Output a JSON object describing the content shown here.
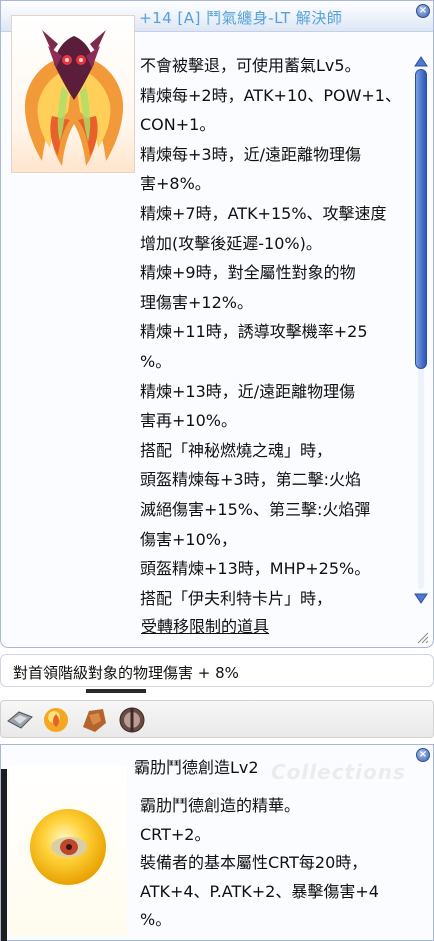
{
  "item": {
    "title": "+14 [A] 鬥氣纏身-LT 解決師",
    "description_lines": [
      "不會被擊退，可使用蓄氣Lv5。",
      "精煉每+2時，ATK+10、POW+1、",
      "CON+1。",
      "精煉每+3時，近/遠距離物理傷",
      "害+8%。",
      "精煉+7時，ATK+15%、攻擊速度",
      "增加(攻擊後延遲-10%)。",
      "精煉+9時，對全屬性對象的物",
      "理傷害+12%。",
      "精煉+11時，誘導攻擊機率+25",
      "%。",
      "精煉+13時，近/遠距離物理傷",
      "害再+10%。",
      "搭配「神秘燃燒之魂」時，",
      "頭盔精煉每+3時，第二擊:火焰",
      "滅絕傷害+15%、第三擊:火焰彈",
      "傷害+10%，",
      "頭盔精煉+13時，MHP+25%。",
      "搭配「伊夫利特卡片」時，"
    ],
    "restriction_label": "受轉移限制的道具",
    "scroll_position_fraction": 0.0
  },
  "random_option": {
    "text": "對首領階級對象的物理傷害 + 8%"
  },
  "slots": [
    {
      "name": "gem-slot-icon"
    },
    {
      "name": "fire-orb-slot-icon"
    },
    {
      "name": "ore-slot-icon"
    },
    {
      "name": "sphere-slot-icon"
    }
  ],
  "card": {
    "name": "霸肋鬥德創造Lv2",
    "watermark": "Collections",
    "description_lines": [
      "霸肋鬥德創造的精華。",
      "CRT+2。",
      "裝備者的基本屬性CRT每20時，",
      "ATK+4、P.ATK+2、暴擊傷害+4",
      "%。"
    ]
  },
  "colors": {
    "title": "#5aa0d4",
    "scroll": "#4e79cf",
    "window_border": "#a9b8d8"
  }
}
